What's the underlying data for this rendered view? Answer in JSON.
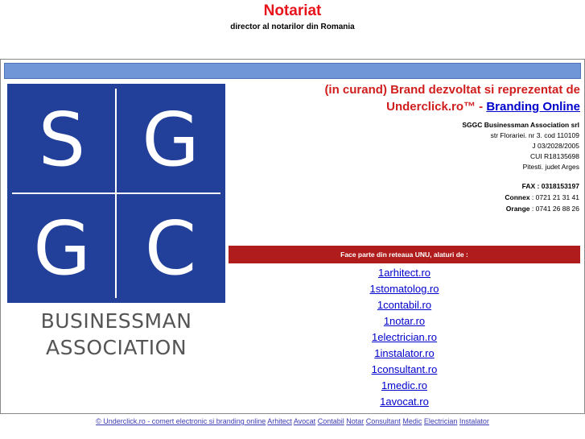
{
  "header": {
    "title": "Notariat",
    "subtitle": "director al notarilor din Romania"
  },
  "logo": {
    "letters": [
      "S",
      "G",
      "G",
      "C"
    ],
    "word1": "BUSINESSMAN",
    "word2": "ASSOCIATION"
  },
  "brand": {
    "line1": "(in curand) Brand dezvoltat si reprezentat de",
    "line2_prefix": "Underclick.ro™ - ",
    "link_label": "Branding Online"
  },
  "address": {
    "company": "SGGC Businessman Association srl",
    "street": "str Florariei. nr 3. cod 110109",
    "reg": "J 03/2028/2005",
    "cui": "CUI R18135698",
    "city": "Pitesti. judet Arges",
    "fax_label": "FAX : ",
    "fax": "0318153197",
    "connex_label": "Connex",
    "connex": " : 0721 21 31 41",
    "orange_label": "Orange",
    "orange": " : 0741 26 88 26"
  },
  "network": {
    "header": "Face parte din reteaua UNU, alaturi de :",
    "sites": [
      "1arhitect.ro",
      "1stomatolog.ro",
      "1contabil.ro",
      "1notar.ro",
      "1electrician.ro",
      "1instalator.ro",
      "1consultant.ro",
      "1medic.ro",
      "1avocat.ro"
    ]
  },
  "footer": {
    "copyright": "© Underclick.ro - comert electronic si branding online",
    "links": [
      "Arhitect",
      "Avocat",
      "Contabil",
      "Notar",
      "Consultant",
      "Medic",
      "Electrician",
      "Instalator"
    ]
  },
  "colors": {
    "title_red": "#e8141c",
    "logo_blue": "#22409a",
    "bar_blue": "#7096d8",
    "bar_red": "#b01c1c",
    "link_blue": "#0000cc"
  }
}
